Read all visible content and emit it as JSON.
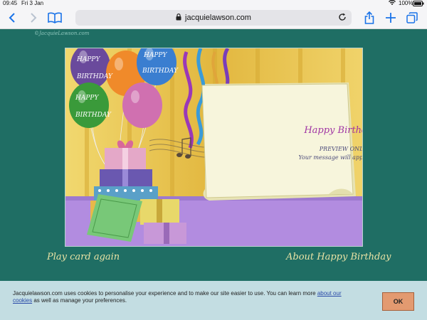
{
  "status_bar": {
    "time": "09:45",
    "date": "Fri 3 Jan",
    "battery": "100%"
  },
  "browser": {
    "url": "jacquielawson.com"
  },
  "page": {
    "copyright": "©JacquieLawson.com",
    "card": {
      "title": "Happy Birthday!",
      "preview": "PREVIEW ONLY",
      "message": "Your message will appear here",
      "balloon_text_1": "HAPPY",
      "balloon_text_2": "BIRTHDAY"
    },
    "play_again": "Play card again",
    "about": "About Happy Birthday"
  },
  "cookie_banner": {
    "text": "Jacquielawson.com uses cookies to personalise your experience and to make our site easier to use. You can learn more",
    "link": "about our cookies",
    "text_after": "as well as manage your preferences.",
    "ok_label": "OK"
  },
  "colors": {
    "page_bg": "#1f6e64",
    "cookie_bg": "#c3dde2",
    "ok_bg": "#e39a70",
    "accent_blue": "#1a73e8"
  }
}
